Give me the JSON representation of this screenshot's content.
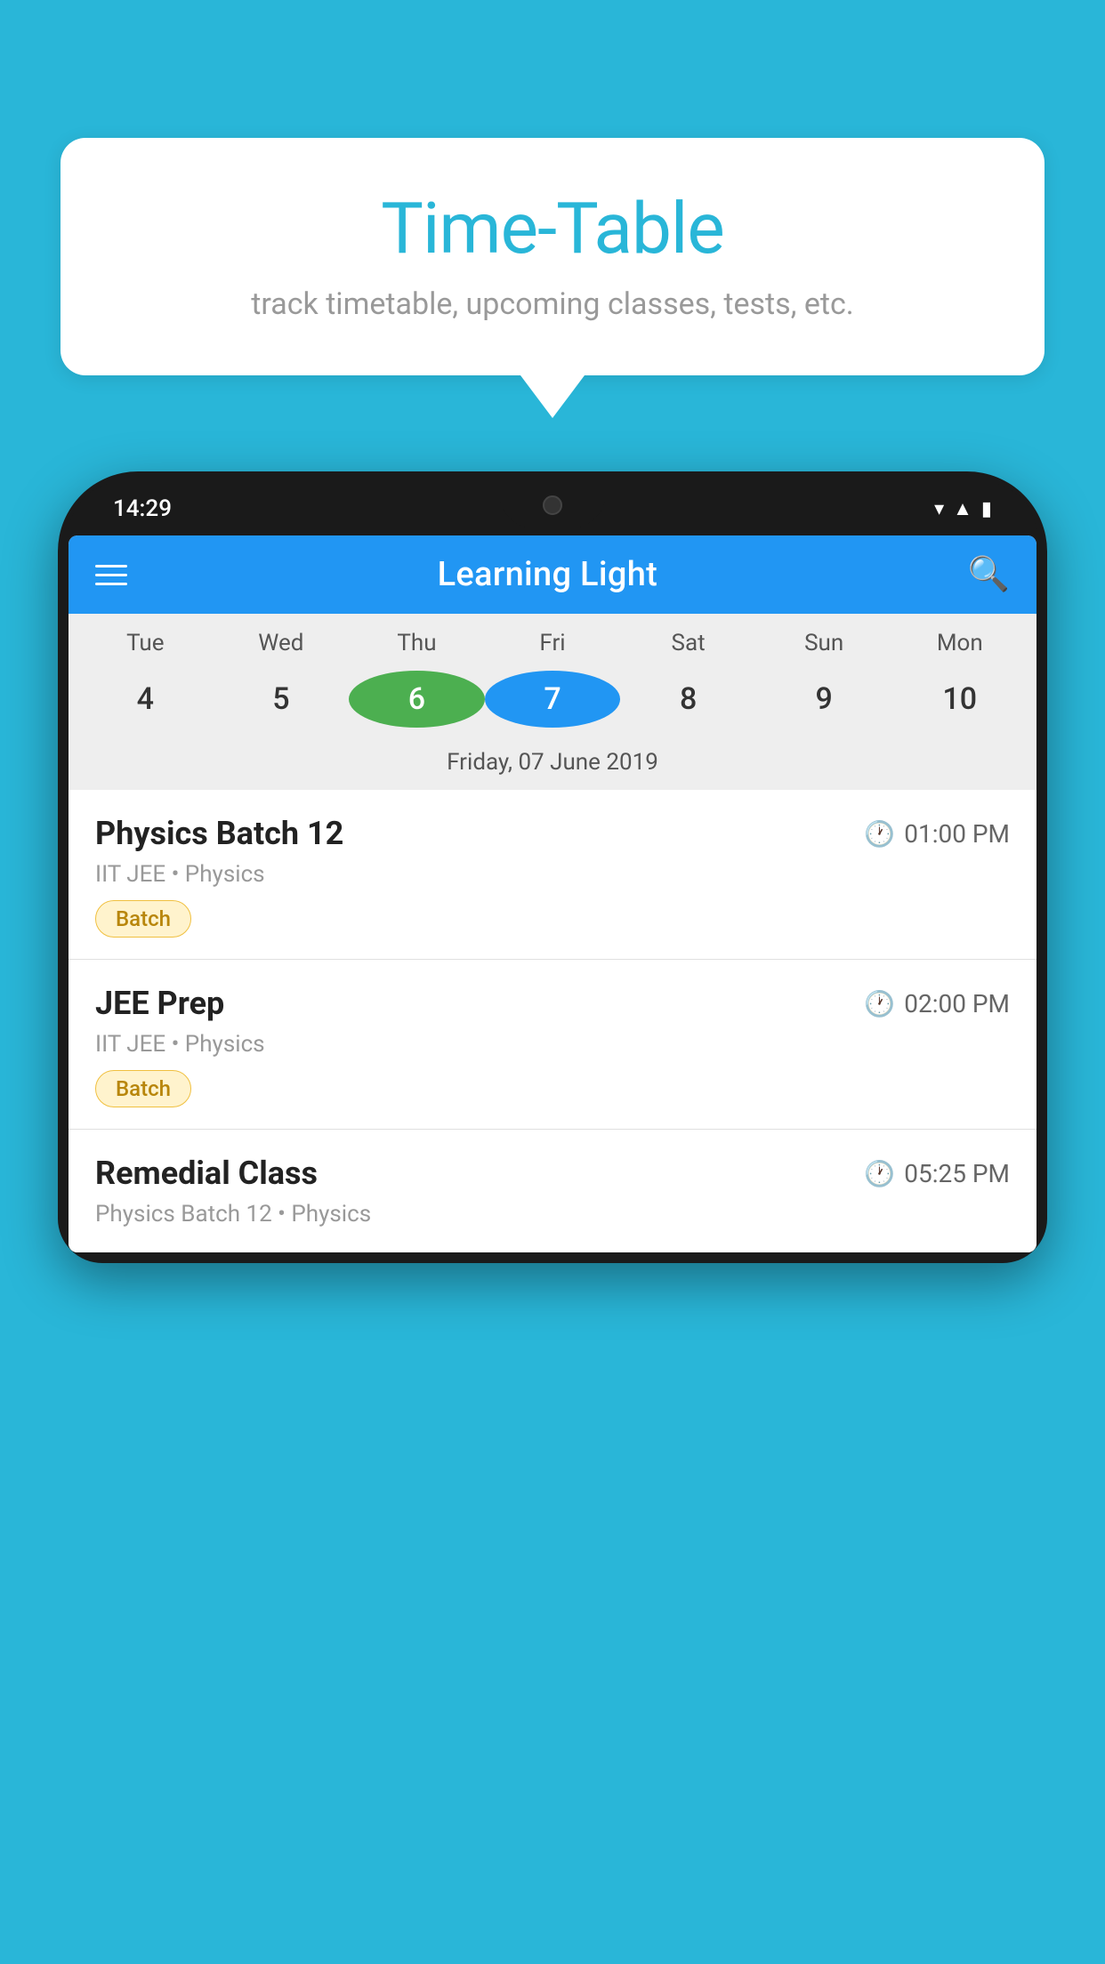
{
  "background_color": "#29b6d8",
  "speech_bubble": {
    "title": "Time-Table",
    "subtitle": "track timetable, upcoming classes, tests, etc."
  },
  "phone": {
    "status_bar": {
      "time": "14:29",
      "icons": [
        "wifi",
        "signal",
        "battery"
      ]
    },
    "app_header": {
      "title": "Learning Light",
      "menu_icon": "hamburger",
      "search_icon": "search"
    },
    "calendar": {
      "weekdays": [
        "Tue",
        "Wed",
        "Thu",
        "Fri",
        "Sat",
        "Sun",
        "Mon"
      ],
      "dates": [
        "4",
        "5",
        "6",
        "7",
        "8",
        "9",
        "10"
      ],
      "today_index": 2,
      "selected_index": 3,
      "selected_label": "Friday, 07 June 2019"
    },
    "classes": [
      {
        "title": "Physics Batch 12",
        "time": "01:00 PM",
        "subtitle": "IIT JEE • Physics",
        "badge": "Batch"
      },
      {
        "title": "JEE Prep",
        "time": "02:00 PM",
        "subtitle": "IIT JEE • Physics",
        "badge": "Batch"
      },
      {
        "title": "Remedial Class",
        "time": "05:25 PM",
        "subtitle": "Physics Batch 12 • Physics",
        "badge": null
      }
    ]
  }
}
